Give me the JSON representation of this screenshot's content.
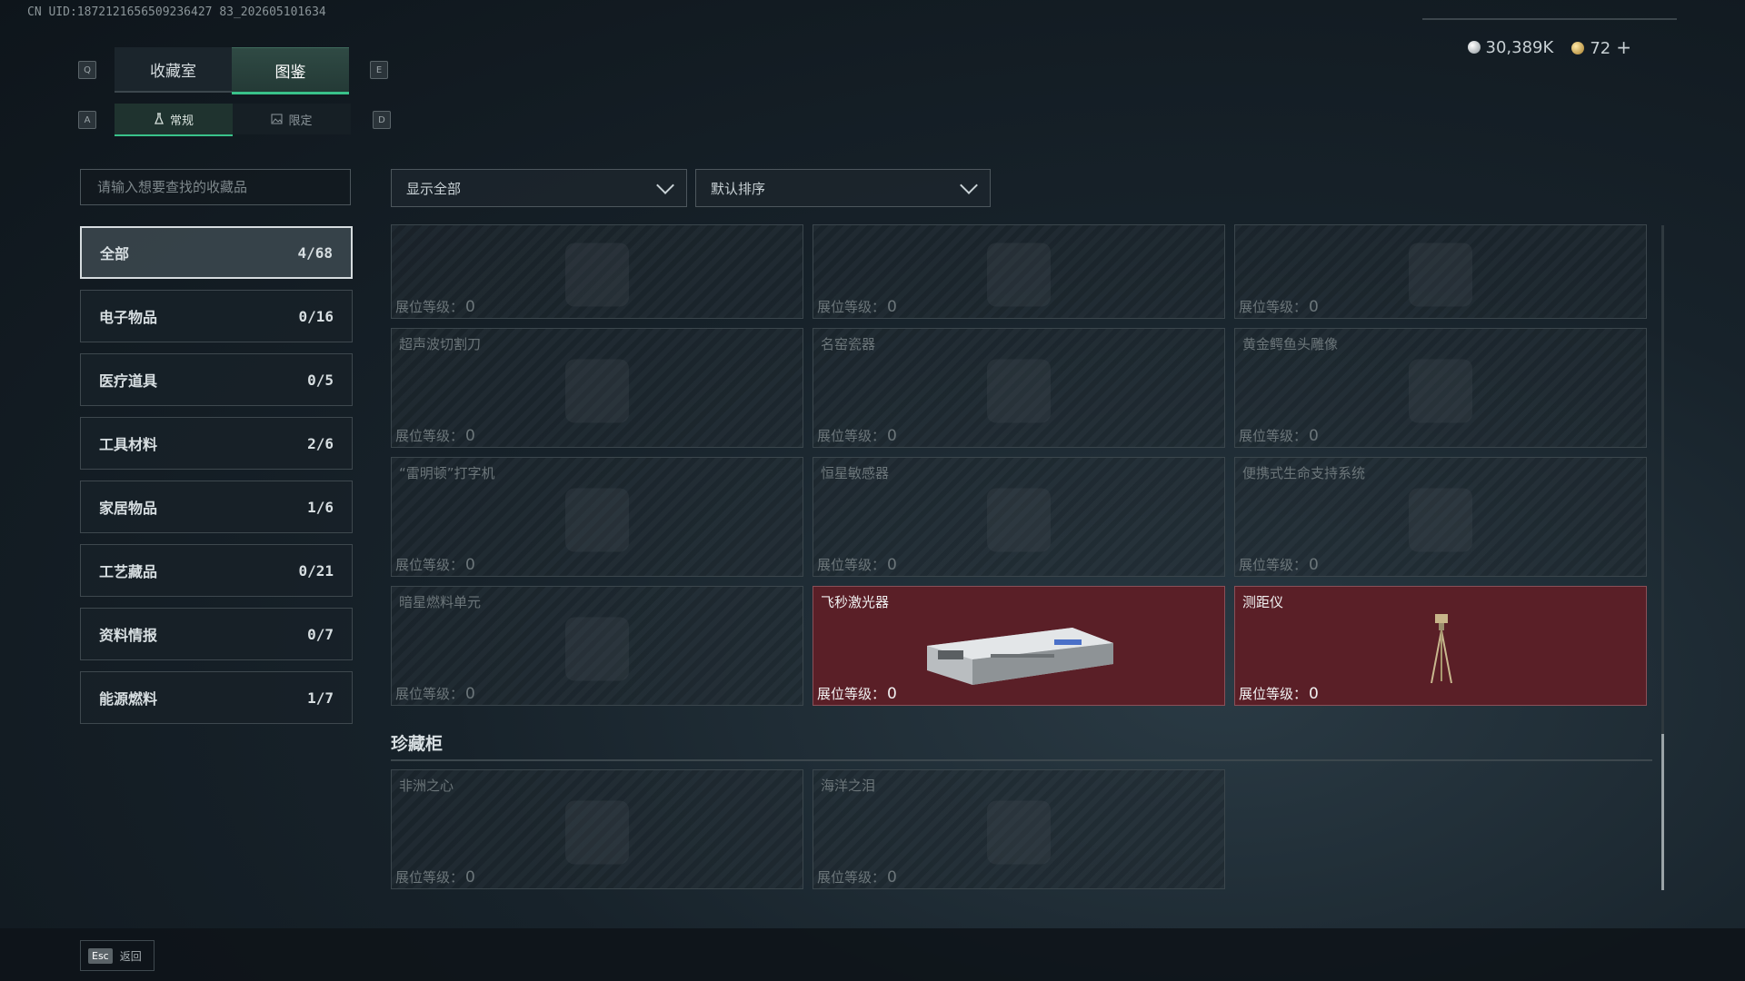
{
  "uid": "CN UID:1872121656509236427 83_202605101634",
  "currency": {
    "silver": "30,389K",
    "gold": "72",
    "plus": "+"
  },
  "keys": {
    "q": "Q",
    "e": "E",
    "a": "A",
    "d": "D",
    "esc": "Esc"
  },
  "main_tabs": [
    {
      "label": "收藏室"
    },
    {
      "label": "图鉴"
    }
  ],
  "sub_tabs": [
    {
      "label": "常规"
    },
    {
      "label": "限定"
    }
  ],
  "search": {
    "placeholder": "请输入想要查找的收藏品"
  },
  "categories": [
    {
      "label": "全部",
      "count": "4/68"
    },
    {
      "label": "电子物品",
      "count": "0/16"
    },
    {
      "label": "医疗道具",
      "count": "0/5"
    },
    {
      "label": "工具材料",
      "count": "2/6"
    },
    {
      "label": "家居物品",
      "count": "1/6"
    },
    {
      "label": "工艺藏品",
      "count": "0/21"
    },
    {
      "label": "资料情报",
      "count": "0/7"
    },
    {
      "label": "能源燃料",
      "count": "1/7"
    }
  ],
  "filters": {
    "show": "显示全部",
    "sort": "默认排序"
  },
  "level_label": "展位等级：",
  "items": [
    {
      "name": "",
      "level": "0"
    },
    {
      "name": "",
      "level": "0"
    },
    {
      "name": "",
      "level": "0"
    },
    {
      "name": "超声波切割刀",
      "level": "0"
    },
    {
      "name": "名窑瓷器",
      "level": "0"
    },
    {
      "name": "黄金鳄鱼头雕像",
      "level": "0"
    },
    {
      "name": "“雷明顿”打字机",
      "level": "0"
    },
    {
      "name": "恒星敏感器",
      "level": "0"
    },
    {
      "name": "便携式生命支持系统",
      "level": "0"
    },
    {
      "name": "暗星燃料单元",
      "level": "0"
    },
    {
      "name": "飞秒激光器",
      "level": "0"
    },
    {
      "name": "测距仪",
      "level": "0"
    }
  ],
  "section": {
    "title": "珍藏柜",
    "items": [
      {
        "name": "非洲之心",
        "level": "0"
      },
      {
        "name": "海洋之泪",
        "level": "0"
      }
    ]
  },
  "footer": {
    "back": "返回"
  }
}
